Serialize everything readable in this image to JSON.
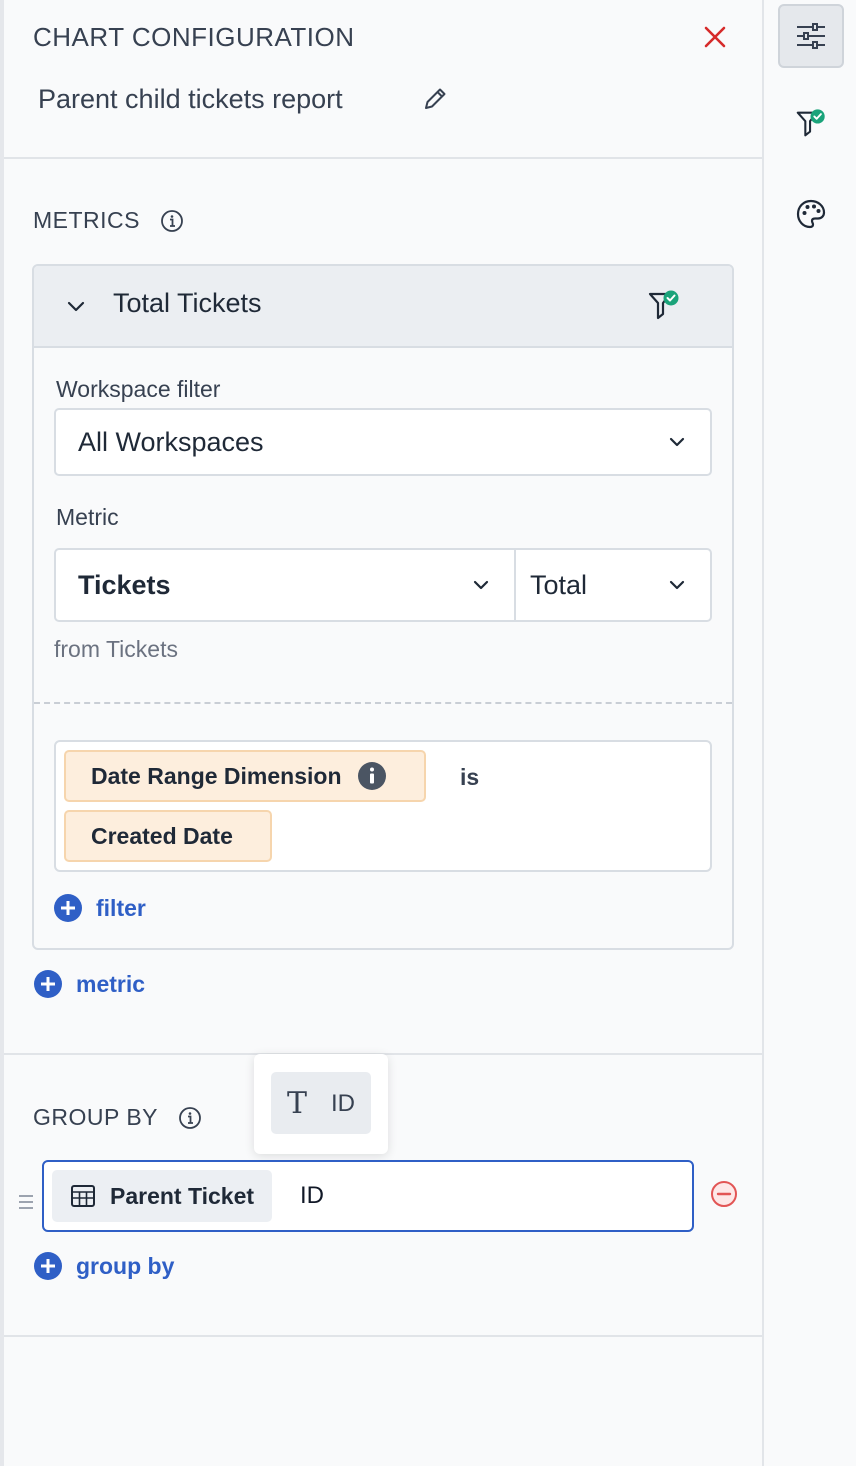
{
  "header": {
    "title": "CHART CONFIGURATION",
    "report_name": "Parent child tickets report"
  },
  "metrics_section": {
    "label": "METRICS",
    "metric": {
      "title": "Total Tickets",
      "workspace_filter_label": "Workspace filter",
      "workspace_filter_value": "All Workspaces",
      "metric_label": "Metric",
      "metric_value": "Tickets",
      "aggregation_value": "Total",
      "source_text": "from Tickets",
      "filter": {
        "dimension_chip": "Date Range Dimension",
        "operator": "is",
        "value_chip": "Created Date"
      },
      "add_filter_label": "filter"
    },
    "add_metric_label": "metric"
  },
  "group_by_section": {
    "label": "GROUP BY",
    "popover_option_label": "ID",
    "table_chip_label": "Parent Ticket",
    "field_value": "ID",
    "add_group_by_label": "group by"
  },
  "colors": {
    "accent": "#2f5fc6",
    "close": "#d62a2a",
    "success": "#1aa37a",
    "chip_bg": "#fdeedd",
    "remove": "#e25555"
  },
  "icons": [
    "close-icon",
    "pencil-icon",
    "info-icon",
    "chevron-down-icon",
    "filter-check-icon",
    "plus-circle-icon",
    "text-type-icon",
    "table-icon",
    "drag-handle-icon",
    "minus-circle-icon",
    "sliders-icon",
    "palette-icon"
  ]
}
